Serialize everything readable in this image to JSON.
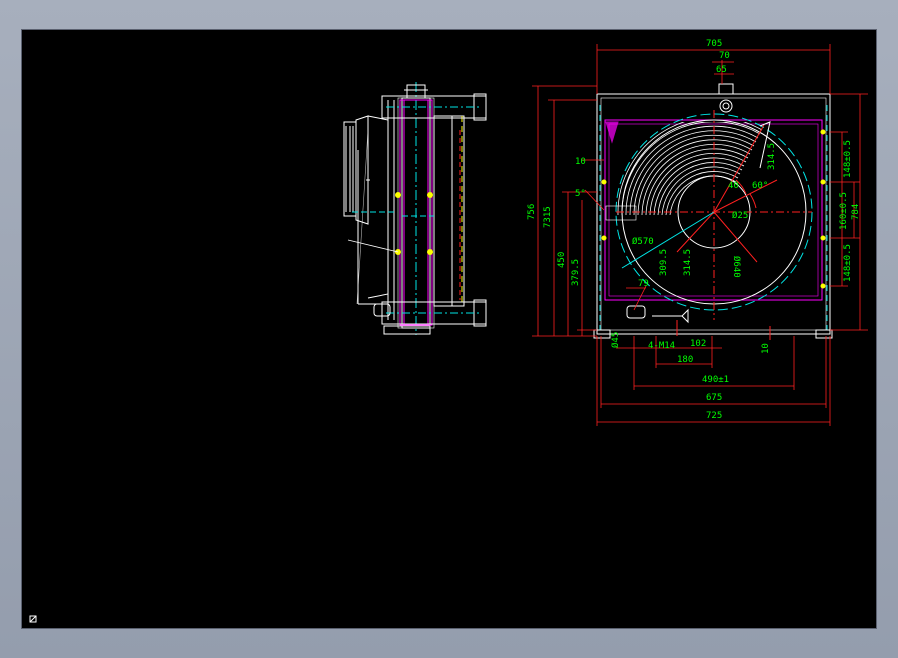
{
  "viewport": {
    "background": "#000000",
    "frame_color": "#5b6170"
  },
  "colors": {
    "outline": "#ffffff",
    "dimension": "#00ff00",
    "center": "#00e5e5",
    "red": "#ff2020",
    "magenta": "#ff00ff",
    "yellow": "#ffff00"
  },
  "dimensions": {
    "top_overall": "705",
    "top_70": "70",
    "top_65": "65",
    "left_756": "756",
    "left_7315": "7315",
    "left_450": "450",
    "left_3795": "379.5",
    "left_10": "10",
    "angle_5": "5°",
    "r_3145_top": "314.5",
    "angle_40": "40",
    "angle_60": "60°",
    "dia_25": "Ø25",
    "dia_570": "Ø570",
    "dim_3095": "309.5",
    "r_3145_bottom": "314.5",
    "dia_640": "Ø640",
    "dim_79": "79",
    "right_148_top": "148±0.5",
    "right_148_bottom": "148±0.5",
    "right_160": "160±0.5",
    "right_784": "784",
    "dia_45": "Ø45",
    "bolts": "4-M14",
    "dim_102": "102",
    "dim_180": "180",
    "dim_10_bottom": "10",
    "dim_490": "490±1",
    "dim_675": "675",
    "dim_725": "725"
  },
  "icons": {
    "ucs": "ucs-icon"
  }
}
